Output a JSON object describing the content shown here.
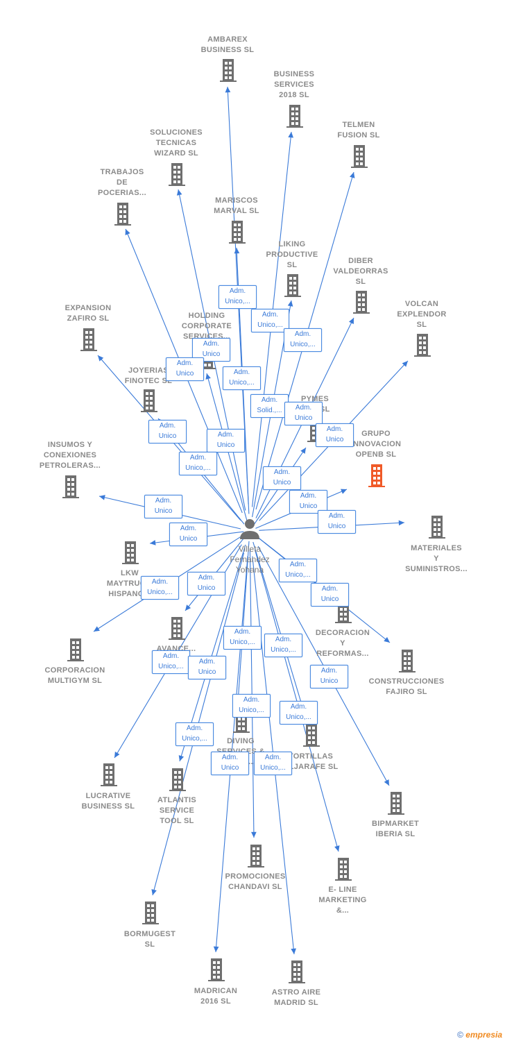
{
  "center_person": {
    "name": "Villeta\nFernandez\nYohana",
    "icon": "person-icon"
  },
  "colors": {
    "edge": "#3a7ad8",
    "building": "#6f6f6f",
    "highlight_building": "#f05a28",
    "label": "#8a8a8a"
  },
  "companies": [
    {
      "name": "AMBAREX\nBUSINESS  SL"
    },
    {
      "name": "BUSINESS\nSERVICES\n2018  SL"
    },
    {
      "name": "TELMEN\nFUSION  SL"
    },
    {
      "name": "SOLUCIONES\nTECNICAS\nWIZARD  SL"
    },
    {
      "name": "TRABAJOS\nDE\nPOCERIAS..."
    },
    {
      "name": "MARISCOS\nMARVAL  SL"
    },
    {
      "name": "LIKING\nPRODUCTIVE\nSL"
    },
    {
      "name": "DIBER\nVALDEORRAS\nSL"
    },
    {
      "name": "VOLCAN\nEXPLENDOR\nSL"
    },
    {
      "name": "EXPANSION\nZAFIRO  SL"
    },
    {
      "name": "HOLDING\nCORPORATE\nSERVICES..."
    },
    {
      "name": "JOYERIAS\nFINOTEC  SL"
    },
    {
      "name": "PYMES\n...SE  SL"
    },
    {
      "name": "GRUPO\nINNOVACION\nOPENB  SL",
      "highlighted": true
    },
    {
      "name": "INSUMOS Y\nCONEXIONES\nPETROLERAS..."
    },
    {
      "name": "MATERIALES\nY\nSUMINISTROS..."
    },
    {
      "name": "LKW\nMAYTRUC...\nHISPANO..."
    },
    {
      "name": "CORPORACION\nMULTIGYM  SL"
    },
    {
      "name": "AVANCE..."
    },
    {
      "name": "DECORACION\nY\nREFORMAS..."
    },
    {
      "name": "CONSTRUCCIONES\nFAJIRO  SL"
    },
    {
      "name": "LUCRATIVE\nBUSINESS  SL"
    },
    {
      "name": "ATLANTIS\nSERVICE\nTOOL  SL"
    },
    {
      "name": "DIVING\nSERVICES &\nC...CT..."
    },
    {
      "name": "TORTILLAS\nALJARAFE  SL"
    },
    {
      "name": "BIPMARKET\nIBERIA  SL"
    },
    {
      "name": "PROMOCIONES\nCHANDAVI  SL"
    },
    {
      "name": "E- LINE\nMARKETING\n&..."
    },
    {
      "name": "BORMUGEST\nSL"
    },
    {
      "name": "MADRICAN\n2016  SL"
    },
    {
      "name": "ASTRO AIRE\nMADRID  SL"
    }
  ],
  "roles": [
    "Adm.\nUnico,...",
    "Adm.\nUnico,...",
    "Adm.\nUnico,...",
    "Adm.\nUnico",
    "Adm.\nUnico",
    "Adm.\nUnico,...",
    "Adm.\nSolid.,...",
    "Adm.\nUnico",
    "Adm.\nUnico",
    "Adm.\nUnico",
    "Adm.\nUnico",
    "Adm.\nUnico,...",
    "Adm.\nUnico",
    "Adm.\nUnico",
    "Adm.\nUnico",
    "Adm.\nUnico",
    "Adm.\nUnico",
    "Adm.\nUnico,...",
    "Adm.\nUnico",
    "Adm.\nUnico,...",
    "Adm.\nUnico",
    "Adm.\nUnico,...",
    "Adm.\nUnico,...",
    "Adm.\nUnico,...",
    "Adm.\nUnico",
    "Adm.\nUnico",
    "Adm.\nUnico,...",
    "Adm.\nUnico,...",
    "Adm.\nUnico,...",
    "Adm.\nUnico",
    "Adm.\nUnico,..."
  ],
  "footer": {
    "copyright": "©",
    "brand": "empresia"
  }
}
